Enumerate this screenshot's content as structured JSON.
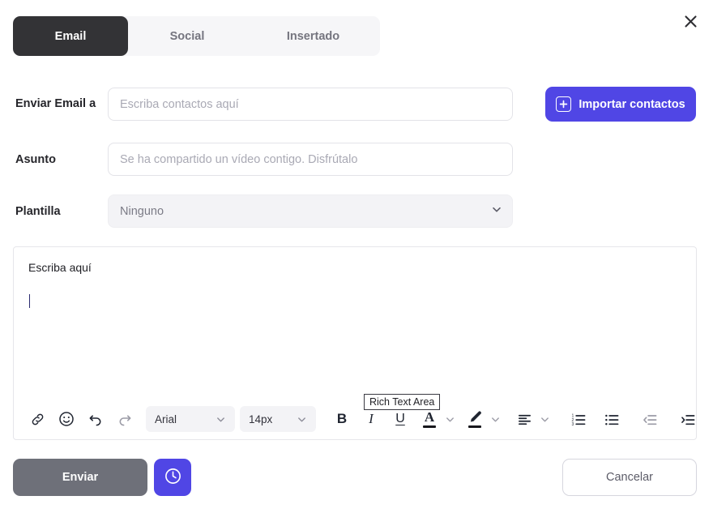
{
  "dialog": {
    "close_label": "close-icon"
  },
  "tabs": [
    {
      "label": "Email",
      "active": true
    },
    {
      "label": "Social",
      "active": false
    },
    {
      "label": "Insertado",
      "active": false
    }
  ],
  "form": {
    "recipients": {
      "label": "Enviar Email a",
      "placeholder": "Escriba contactos aquí",
      "value": ""
    },
    "subject": {
      "label": "Asunto",
      "placeholder": "Se ha compartido un vídeo contigo. Disfrútalo",
      "value": ""
    },
    "template": {
      "label": "Plantilla",
      "value": "Ninguno",
      "options": [
        "Ninguno"
      ]
    },
    "import_button": "Importar contactos"
  },
  "editor": {
    "content": "Escriba aquí",
    "tooltip": "Rich Text Area",
    "toolbar": {
      "font_family": "Arial",
      "font_size": "14px",
      "buttons": [
        "link-icon",
        "emoji-icon",
        "undo-icon",
        "redo-icon",
        "bold-icon",
        "italic-icon",
        "underline-icon",
        "text-color-icon",
        "highlight-color-icon",
        "align-left-icon",
        "ordered-list-icon",
        "unordered-list-icon",
        "outdent-icon",
        "indent-icon"
      ],
      "bold_label": "B",
      "italic_label": "I",
      "underline_label": "U",
      "text_color_label": "A"
    }
  },
  "footer": {
    "send_label": "Enviar",
    "schedule_label": "schedule-clock-icon",
    "cancel_label": "Cancelar"
  },
  "colors": {
    "accent": "#5046e5",
    "tab_active_bg": "#333336",
    "send_disabled_bg": "#6e7079"
  }
}
